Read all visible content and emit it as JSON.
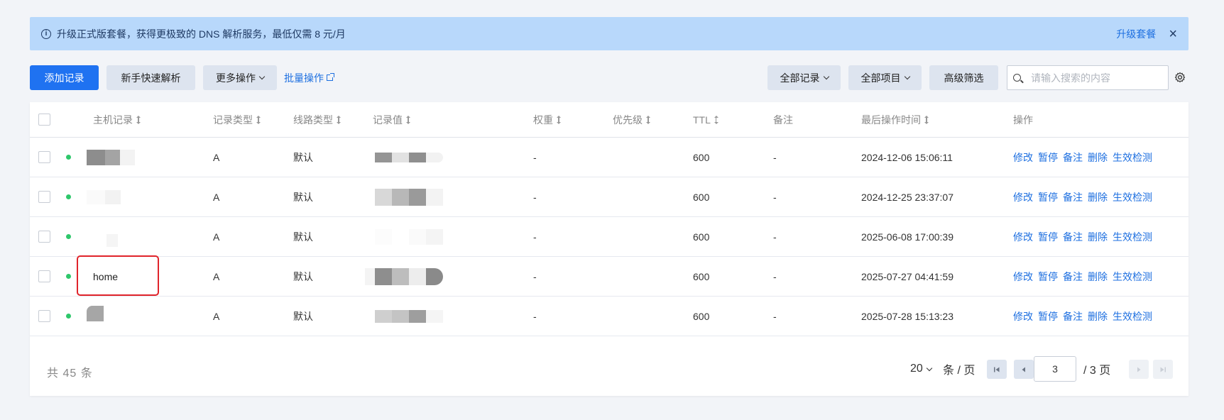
{
  "banner": {
    "text": "升级正式版套餐，获得更极致的 DNS 解析服务，最低仅需 8 元/月",
    "upgrade_label": "升级套餐",
    "close_label": "×"
  },
  "toolbar": {
    "add_label": "添加记录",
    "quick_label": "新手快速解析",
    "more_label": "更多操作",
    "batch_label": "批量操作",
    "all_records_label": "全部记录",
    "all_projects_label": "全部项目",
    "advanced_label": "高级筛选",
    "search_placeholder": "请输入搜索的内容"
  },
  "table": {
    "headers": {
      "host": "主机记录",
      "type": "记录类型",
      "line": "线路类型",
      "value": "记录值",
      "weight": "权重",
      "priority": "优先级",
      "ttl": "TTL",
      "remark": "备注",
      "time": "最后操作时间",
      "ops": "操作"
    },
    "op_labels": [
      "修改",
      "暂停",
      "备注",
      "删除",
      "生效检测"
    ],
    "rows": [
      {
        "host": "",
        "type": "A",
        "line": "默认",
        "weight": "-",
        "priority": "",
        "ttl": "600",
        "remark": "-",
        "time": "2024-12-06 15:06:11"
      },
      {
        "host": "",
        "type": "A",
        "line": "默认",
        "weight": "-",
        "priority": "",
        "ttl": "600",
        "remark": "-",
        "time": "2024-12-25 23:37:07"
      },
      {
        "host": "",
        "type": "A",
        "line": "默认",
        "weight": "-",
        "priority": "",
        "ttl": "600",
        "remark": "-",
        "time": "2025-06-08 17:00:39"
      },
      {
        "host": "home",
        "type": "A",
        "line": "默认",
        "weight": "-",
        "priority": "",
        "ttl": "600",
        "remark": "-",
        "time": "2025-07-27 04:41:59"
      },
      {
        "host": "",
        "type": "A",
        "line": "默认",
        "weight": "-",
        "priority": "",
        "ttl": "600",
        "remark": "-",
        "time": "2025-07-28 15:13:23"
      }
    ]
  },
  "pagination": {
    "total": "共 45 条",
    "page_size": "20",
    "per_page_label": "条 / 页",
    "current_page": "3",
    "total_pages_label": "/ 3 页"
  },
  "colors": {
    "accent": "#1f72f1",
    "banner_bg": "#b8d8fb",
    "status_ok": "#2ec76b",
    "highlight": "#e0242b"
  }
}
